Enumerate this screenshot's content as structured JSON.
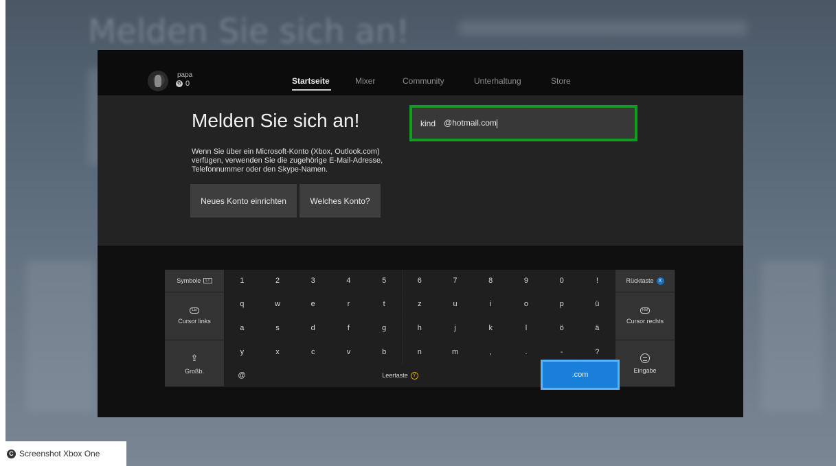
{
  "background": {
    "title": "Melden Sie sich an!"
  },
  "profile": {
    "name": "papa",
    "score": "0",
    "score_icon": "G"
  },
  "nav": {
    "items": [
      {
        "label": "Startseite",
        "active": true
      },
      {
        "label": "Mixer"
      },
      {
        "label": "Community"
      },
      {
        "label": "Unterhaltung"
      },
      {
        "label": "Store"
      }
    ]
  },
  "signin": {
    "heading": "Melden Sie sich an!",
    "description": "Wenn Sie über ein Microsoft-Konto (Xbox, Outlook.com) verfügen, verwenden Sie die zugehörige E-Mail-Adresse, Telefonnummer oder den Skype-Namen.",
    "btn_new": "Neues Konto einrichten",
    "btn_which": "Welches Konto?",
    "email_name": "kind",
    "email_domain": "@hotmail.com"
  },
  "keyboard": {
    "symbols": "Symbole",
    "symbols_badge": "LT",
    "row1": [
      "1",
      "2",
      "3",
      "4",
      "5",
      "6",
      "7",
      "8",
      "9",
      "0",
      "!"
    ],
    "row2": [
      "q",
      "w",
      "e",
      "r",
      "t",
      "z",
      "u",
      "i",
      "o",
      "p",
      "ü"
    ],
    "row3": [
      "a",
      "s",
      "d",
      "f",
      "g",
      "h",
      "j",
      "k",
      "l",
      "ö",
      "ä"
    ],
    "row4": [
      "y",
      "x",
      "c",
      "v",
      "b",
      "n",
      "m",
      ",",
      ".",
      "-",
      "?"
    ],
    "backspace": "Rücktaste",
    "backspace_badge": "X",
    "cursor_left": "Cursor links",
    "cursor_left_badge": "LB",
    "cursor_right": "Cursor rechts",
    "cursor_right_badge": "RB",
    "shift": "Großb.",
    "at": "@",
    "space": "Leertaste",
    "space_badge": "Y",
    "dotcom": ".com",
    "enter": "Eingabe"
  },
  "caption": {
    "text": "Screenshot Xbox One",
    "icon": "C"
  },
  "colors": {
    "focus_green": "#139c22",
    "key_blue": "#1a7fd8"
  }
}
